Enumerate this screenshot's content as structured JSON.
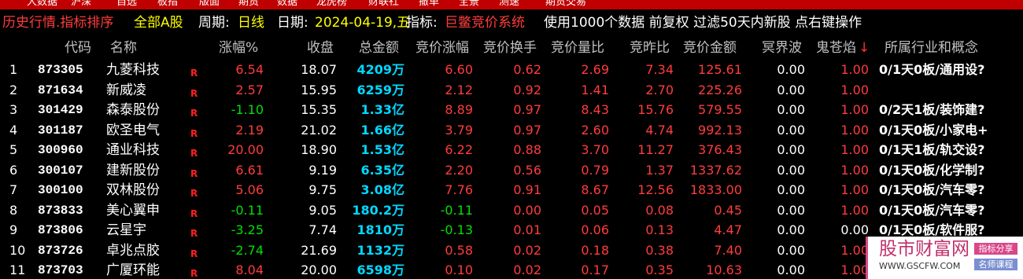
{
  "menu": [
    "大数据",
    "沪深",
    "自选",
    "板指",
    "版面",
    "期货",
    "数据",
    "龙虎榜",
    "财联社",
    "撤单",
    "全景",
    "测速",
    "期货交易"
  ],
  "info": {
    "title": "历史行情.指标排序",
    "market": "全部A股",
    "period_label": "周期:",
    "period": "日线",
    "date_label": "日期:",
    "date": "2024-04-19,五",
    "indicator_label": "指标:",
    "indicator": "巨鳖竞价系统",
    "note": "使用1000个数据 前复权 过滤50天内新股 点右键操作"
  },
  "columns": [
    "代码",
    "名称",
    "涨幅%",
    "收盘",
    "总金额",
    "竞价涨幅",
    "竞价换手",
    "竞价量比",
    "竞昨比",
    "竞价金额",
    "冥界波",
    "鬼苍焰",
    "所属行业和概念"
  ],
  "sort_arrow": "↓",
  "rows": [
    {
      "idx": "1",
      "code": "873305",
      "name": "九菱科技",
      "flag": "R",
      "chg": "6.54",
      "close": "18.07",
      "amount": "4209万",
      "bid_chg": "6.60",
      "bid_turn": "0.62",
      "bid_vr": "2.69",
      "bid_prev": "7.34",
      "bid_amt": "125.61",
      "w1": "0.00",
      "w2": "1.00",
      "concept": "0/1天0板/通用设?"
    },
    {
      "idx": "2",
      "code": "871634",
      "name": "新威凌",
      "flag": "R",
      "chg": "2.57",
      "close": "15.95",
      "amount": "6259万",
      "bid_chg": "2.12",
      "bid_turn": "0.92",
      "bid_vr": "1.41",
      "bid_prev": "2.70",
      "bid_amt": "225.26",
      "w1": "0.00",
      "w2": "1.00",
      "concept": ""
    },
    {
      "idx": "3",
      "code": "301429",
      "name": "森泰股份",
      "flag": "R",
      "chg": "-1.10",
      "close": "15.35",
      "amount": "1.33亿",
      "bid_chg": "8.89",
      "bid_turn": "0.97",
      "bid_vr": "8.43",
      "bid_prev": "15.76",
      "bid_amt": "579.55",
      "w1": "0.00",
      "w2": "1.00",
      "concept": "0/2天1板/装饰建?"
    },
    {
      "idx": "4",
      "code": "301187",
      "name": "欧圣电气",
      "flag": "R",
      "chg": "2.19",
      "close": "21.02",
      "amount": "1.66亿",
      "bid_chg": "3.79",
      "bid_turn": "0.97",
      "bid_vr": "2.60",
      "bid_prev": "4.74",
      "bid_amt": "992.13",
      "w1": "0.00",
      "w2": "1.00",
      "concept": "0/1天0板/小家电+"
    },
    {
      "idx": "5",
      "code": "300960",
      "name": "通业科技",
      "flag": "R",
      "chg": "20.00",
      "close": "18.90",
      "amount": "1.53亿",
      "bid_chg": "6.22",
      "bid_turn": "0.88",
      "bid_vr": "3.70",
      "bid_prev": "11.27",
      "bid_amt": "376.43",
      "w1": "0.00",
      "w2": "1.00",
      "concept": "0/1天1板/轨交设?"
    },
    {
      "idx": "6",
      "code": "300107",
      "name": "建新股份",
      "flag": "R",
      "chg": "6.61",
      "close": "9.19",
      "amount": "6.35亿",
      "bid_chg": "2.20",
      "bid_turn": "0.56",
      "bid_vr": "0.79",
      "bid_prev": "1.37",
      "bid_amt": "1337.62",
      "w1": "0.00",
      "w2": "1.00",
      "concept": "0/1天0板/化学制?"
    },
    {
      "idx": "7",
      "code": "300100",
      "name": "双林股份",
      "flag": "R",
      "chg": "5.06",
      "close": "9.75",
      "amount": "3.08亿",
      "bid_chg": "7.76",
      "bid_turn": "0.91",
      "bid_vr": "8.67",
      "bid_prev": "12.56",
      "bid_amt": "1833.00",
      "w1": "0.00",
      "w2": "1.00",
      "concept": "0/1天0板/汽车零?"
    },
    {
      "idx": "8",
      "code": "873833",
      "name": "美心翼申",
      "flag": "R",
      "chg": "-0.11",
      "close": "9.05",
      "amount": "180.2万",
      "bid_chg": "-0.11",
      "bid_turn": "0.00",
      "bid_vr": "0.05",
      "bid_prev": "0.08",
      "bid_amt": "0.45",
      "w1": "0.00",
      "w2": "1.00",
      "concept": "0/1天0板/汽车零?"
    },
    {
      "idx": "9",
      "code": "873806",
      "name": "云星宇",
      "flag": "R",
      "chg": "-3.25",
      "close": "7.74",
      "amount": "1810万",
      "bid_chg": "-0.13",
      "bid_turn": "0.01",
      "bid_vr": "0.06",
      "bid_prev": "0.13",
      "bid_amt": "4.47",
      "w1": "0.00",
      "w2": "0.00",
      "concept": "0/1天0板/软件服?"
    },
    {
      "idx": "10",
      "code": "873726",
      "name": "卓兆点胶",
      "flag": "R",
      "chg": "-2.74",
      "close": "21.69",
      "amount": "1132万",
      "bid_chg": "0.58",
      "bid_turn": "0.02",
      "bid_vr": "0.18",
      "bid_prev": "0.38",
      "bid_amt": "7.40",
      "w1": "0.00",
      "w2": "1.00",
      "concept": ""
    },
    {
      "idx": "11",
      "code": "873703",
      "name": "广厦环能",
      "flag": "R",
      "chg": "8.04",
      "close": "20.00",
      "amount": "6598万",
      "bid_chg": "0.10",
      "bid_turn": "0.02",
      "bid_vr": "0.17",
      "bid_prev": "0.35",
      "bid_amt": "10.63",
      "w1": "0.00",
      "w2": "1.00",
      "concept": ""
    }
  ],
  "watermark": {
    "site": "股市财富网",
    "url": "WWW.GSCFW.COM",
    "tag1": "指标分享",
    "tag2": "名师课程"
  },
  "colors": {
    "rise": "#ff3c3c",
    "fall": "#00e000",
    "amount": "#00d8ff",
    "title": "#ff3c3c",
    "highlight": "#ffff00"
  }
}
